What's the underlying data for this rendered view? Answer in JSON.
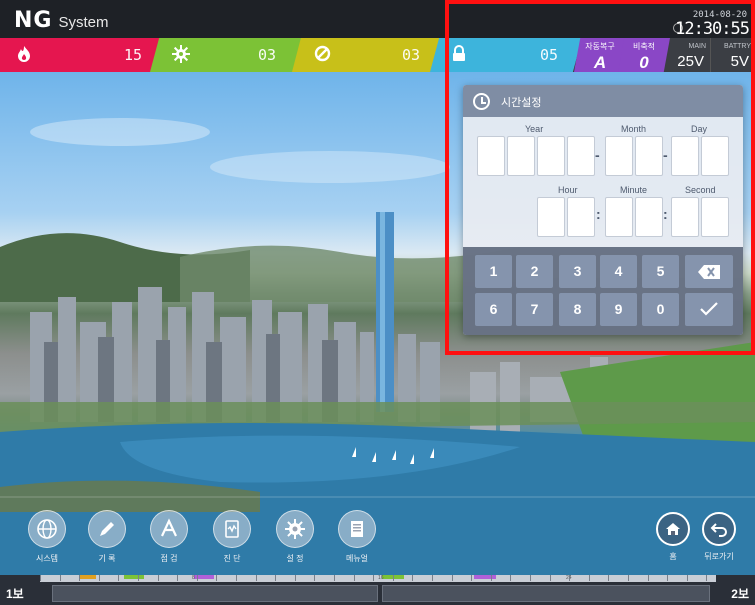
{
  "header": {
    "logo_ng": "NG",
    "logo_system": "System",
    "date": "2014-08-20",
    "time": "12:30:55"
  },
  "status_bar": {
    "fire": {
      "icon": "fire-icon",
      "count": "15",
      "color": "#e5164f"
    },
    "trouble": {
      "icon": "gear-icon",
      "count": "03",
      "color": "#7cc236"
    },
    "blocked": {
      "icon": "block-icon",
      "count": "03",
      "color": "#c8c019"
    },
    "lock": {
      "icon": "lock-icon",
      "count": "05",
      "color": "#3db4dc"
    },
    "auto_restore": {
      "label": "자동복구",
      "value": "A"
    },
    "emergency": {
      "label": "비축적",
      "value": "0"
    },
    "main": {
      "label": "MAIN",
      "value": "25V"
    },
    "battery": {
      "label": "BATTRY",
      "value": "5V"
    }
  },
  "time_dialog": {
    "title": "시간설정",
    "labels": {
      "year": "Year",
      "month": "Month",
      "day": "Day",
      "hour": "Hour",
      "minute": "Minute",
      "second": "Second"
    },
    "keys": [
      "1",
      "2",
      "3",
      "4",
      "5",
      "6",
      "7",
      "8",
      "9",
      "0"
    ],
    "backspace_icon": "backspace-icon",
    "confirm_icon": "check-icon"
  },
  "nav": {
    "system": "시스템",
    "record": "기  록",
    "inspect": "점  검",
    "diagnose": "진  단",
    "settings": "설  정",
    "manual": "메뉴얼",
    "home": "홈",
    "back": "뒤로가기"
  },
  "floor_bar": {
    "left_label": "1보",
    "right_label": "2보",
    "tick_labels": [
      "8",
      "16",
      "24"
    ]
  },
  "colors": {
    "accent_red": "#ff1010",
    "purple": "#8a47c6",
    "orange_mark": "#e0a020",
    "green_mark": "#7cc236",
    "purple_mark": "#b060d8"
  }
}
